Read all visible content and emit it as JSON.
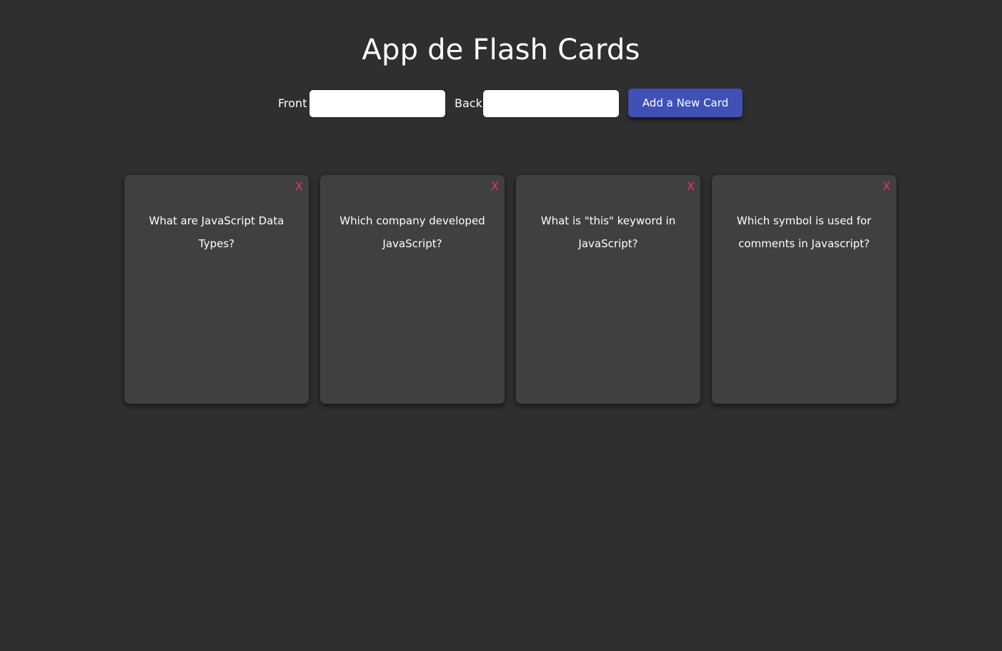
{
  "header": {
    "title": "App de Flash Cards"
  },
  "form": {
    "front_label": "Front",
    "front_value": "",
    "back_label": "Back",
    "back_value": "",
    "add_button_label": "Add a New Card"
  },
  "cards": [
    {
      "front": "What are JavaScript Data Types?",
      "delete_label": "X"
    },
    {
      "front": "Which company developed JavaScript?",
      "delete_label": "X"
    },
    {
      "front": "What is \"this\" keyword in JavaScript?",
      "delete_label": "X"
    },
    {
      "front": "Which symbol is used for comments in Javascript?",
      "delete_label": "X"
    }
  ],
  "colors": {
    "background": "#2f2f2f",
    "card_background": "#404040",
    "accent_button": "#3f51b5",
    "delete_icon": "#e7336b"
  },
  "icons": {
    "delete": "close-icon"
  }
}
